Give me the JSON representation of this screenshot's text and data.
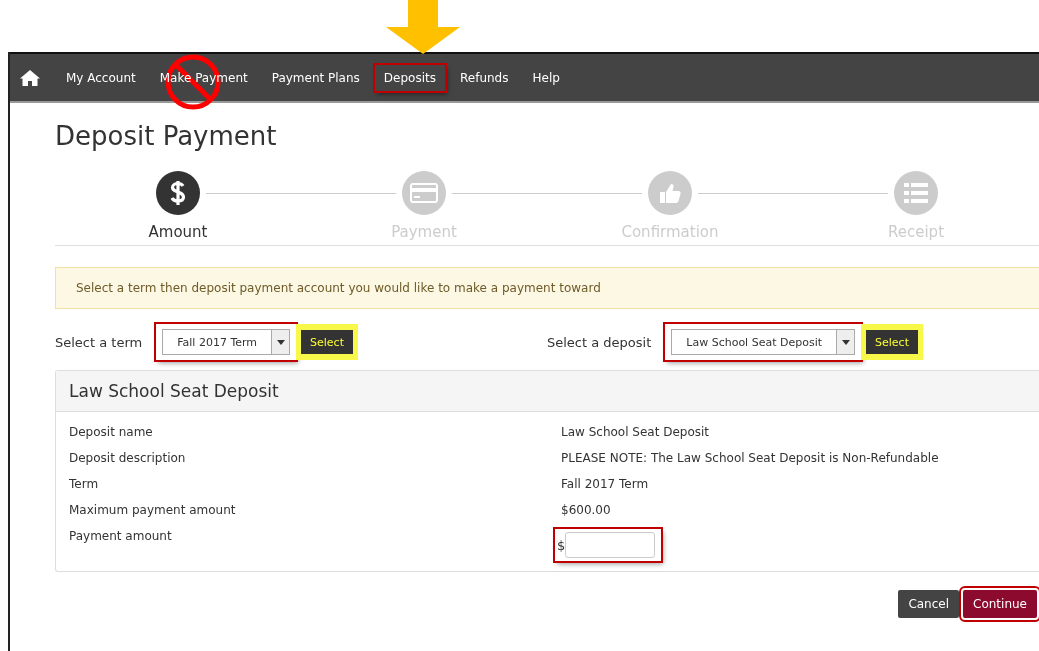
{
  "nav": {
    "items": [
      {
        "label": "My Account",
        "outlined": false,
        "crossed_out": false
      },
      {
        "label": "Make Payment",
        "outlined": false,
        "crossed_out": true
      },
      {
        "label": "Payment Plans",
        "outlined": false,
        "crossed_out": false
      },
      {
        "label": "Deposits",
        "outlined": true,
        "crossed_out": false
      },
      {
        "label": "Refunds",
        "outlined": false,
        "crossed_out": false
      },
      {
        "label": "Help",
        "outlined": false,
        "crossed_out": false
      }
    ]
  },
  "title": "Deposit Payment",
  "steps": [
    {
      "label": "Amount",
      "active": true
    },
    {
      "label": "Payment",
      "active": false
    },
    {
      "label": "Confirmation",
      "active": false
    },
    {
      "label": "Receipt",
      "active": false
    }
  ],
  "alert": "Select a term then deposit payment account you would like to make a payment toward",
  "selectors": [
    {
      "label": "Select a term",
      "value": "Fall 2017 Term",
      "button": "Select",
      "outlined": true,
      "highlighted": true
    },
    {
      "label": "Select a deposit",
      "value": "Law School Seat Deposit",
      "button": "Select",
      "outlined": true,
      "highlighted": true
    }
  ],
  "panel": {
    "title": "Law School Seat Deposit",
    "rows": [
      {
        "kind": "text",
        "label": "Deposit name",
        "value": "Law School Seat Deposit"
      },
      {
        "kind": "text",
        "label": "Deposit description",
        "value": "PLEASE NOTE: The Law School Seat Deposit is Non-Refundable"
      },
      {
        "kind": "text",
        "label": "Term",
        "value": "Fall 2017 Term"
      },
      {
        "kind": "text",
        "label": "Maximum payment amount",
        "value": "$600.00"
      },
      {
        "kind": "input",
        "label": "Payment amount",
        "prefix": "$",
        "outlined": true
      }
    ]
  },
  "buttons": [
    {
      "label": "Cancel",
      "kind": "secondary",
      "outlined": false
    },
    {
      "label": "Continue",
      "kind": "primary",
      "outlined": true
    }
  ]
}
